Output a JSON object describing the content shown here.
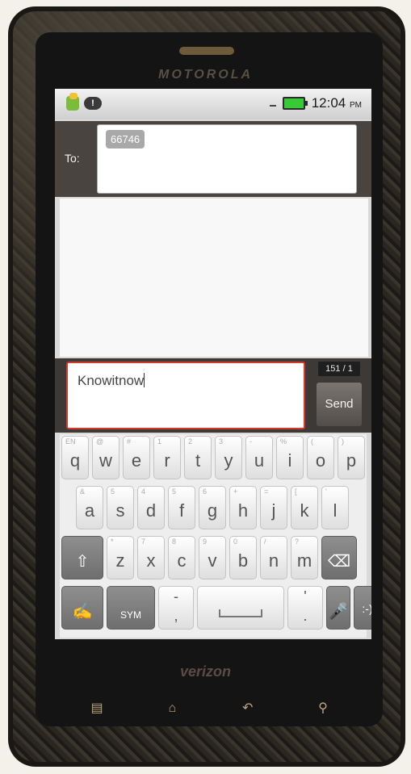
{
  "device": {
    "brand": "MOTOROLA",
    "carrier": "verizon"
  },
  "status_bar": {
    "icons": [
      "app-notification-icon",
      "yahoo-messenger-icon"
    ],
    "time": "12:04",
    "ampm": "PM",
    "battery_color": "#35c935"
  },
  "compose": {
    "to_label": "To:",
    "recipient_chip": "66746",
    "message_text": "Knowitnow",
    "char_counter": "151 / 1",
    "send_label": "Send",
    "accent_color": "#d43a2c"
  },
  "keyboard": {
    "row1": [
      {
        "key": "q",
        "hint": "EN"
      },
      {
        "key": "w",
        "hint": "@"
      },
      {
        "key": "e",
        "hint": "#"
      },
      {
        "key": "r",
        "hint": "1"
      },
      {
        "key": "t",
        "hint": "2"
      },
      {
        "key": "y",
        "hint": "3"
      },
      {
        "key": "u",
        "hint": "-"
      },
      {
        "key": "i",
        "hint": "%"
      },
      {
        "key": "o",
        "hint": "("
      },
      {
        "key": "p",
        "hint": ")"
      }
    ],
    "row2": [
      {
        "key": "a",
        "hint": "&"
      },
      {
        "key": "s",
        "hint": "5"
      },
      {
        "key": "d",
        "hint": "4"
      },
      {
        "key": "f",
        "hint": "5"
      },
      {
        "key": "g",
        "hint": "6"
      },
      {
        "key": "h",
        "hint": "+"
      },
      {
        "key": "j",
        "hint": "="
      },
      {
        "key": "k",
        "hint": "["
      },
      {
        "key": "l",
        "hint": "'"
      }
    ],
    "row3": [
      {
        "key": "z",
        "hint": "*"
      },
      {
        "key": "x",
        "hint": "7"
      },
      {
        "key": "c",
        "hint": "8"
      },
      {
        "key": "v",
        "hint": "9"
      },
      {
        "key": "b",
        "hint": "0"
      },
      {
        "key": "n",
        "hint": "/"
      },
      {
        "key": "m",
        "hint": "?"
      }
    ],
    "sym_label": "SYM",
    "smiley_label": ":-)"
  },
  "nav_buttons": [
    "menu-icon",
    "home-icon",
    "back-icon",
    "search-icon"
  ]
}
